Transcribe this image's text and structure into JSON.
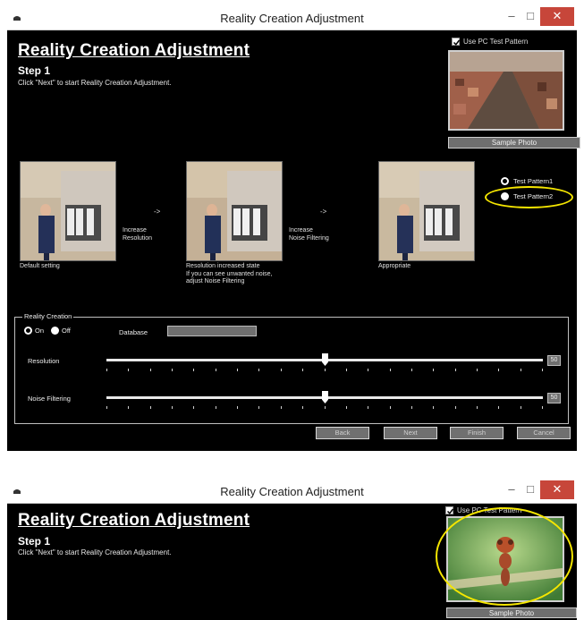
{
  "window": {
    "title": "Reality Creation Adjustment",
    "controls": {
      "minimize": "–",
      "maximize": "□",
      "close": "✕"
    }
  },
  "heading": "Reality Creation Adjustment",
  "step": "Step 1",
  "instruction": "Click \"Next\" to start Reality Creation Adjustment.",
  "pc_test_pattern": {
    "label": "Use PC Test Pattern",
    "checked": true
  },
  "sample_photo_button": "Sample Photo",
  "thumbnails": [
    {
      "caption": "Default setting"
    },
    {
      "caption_lines": [
        "Resolution increased state",
        "If you  can see unwanted noise,",
        "adjust Noise Filtering"
      ]
    },
    {
      "caption": "Appropriate"
    }
  ],
  "steps_arrows": [
    {
      "arrow": "->",
      "lines": [
        "Increase",
        "Resolution"
      ]
    },
    {
      "arrow": "->",
      "lines": [
        "Increase",
        "Noise Filtering"
      ]
    }
  ],
  "test_patterns": [
    {
      "label": "Test Pattern1",
      "selected": true
    },
    {
      "label": "Test Pattern2",
      "selected": false
    }
  ],
  "reality_creation": {
    "group_label": "Reality Creation",
    "on_label": "On",
    "off_label": "Off",
    "selected": "On",
    "database_label": "Database",
    "resolution": {
      "label": "Resolution",
      "value": "50",
      "level": 0.5
    },
    "noise_filtering": {
      "label": "Noise Filtering",
      "value": "50",
      "level": 0.5
    }
  },
  "buttons": {
    "back": "Back",
    "next": "Next",
    "finish": "Finish",
    "cancel": "Cancel"
  },
  "colors": {
    "highlight": "#f5e600",
    "close": "#c7463a",
    "button": "#707070"
  }
}
